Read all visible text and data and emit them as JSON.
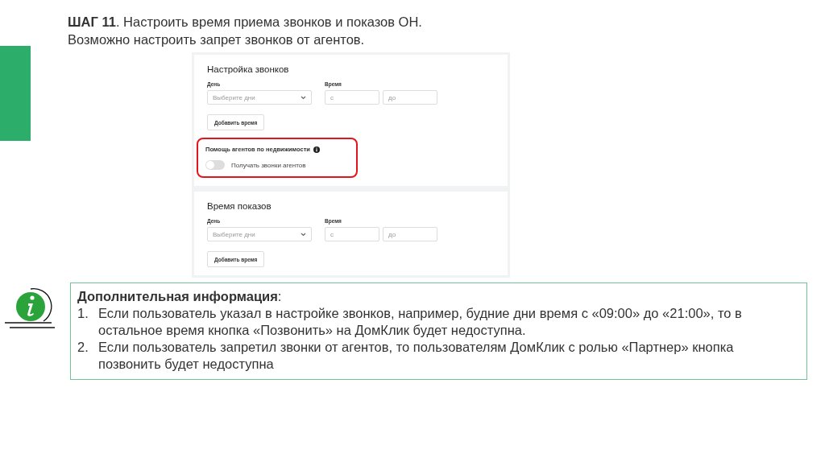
{
  "title_lines": [
    "**ШАГ 11**. Настроить время приема звонков и показов ОН.",
    "Возможно настроить запрет звонков от агентов."
  ],
  "sections": [
    {
      "heading": "Настройка звонков",
      "day_label": "День",
      "day_placeholder": "Выберите дни",
      "time_label": "Время",
      "from_placeholder": "с",
      "to_placeholder": "до",
      "button": "Добавить время",
      "agents": {
        "heading": "Помощь агентов по недвижимости",
        "toggle_label": "Получать звонки агентов",
        "on": false,
        "highlighted": true
      }
    },
    {
      "heading": "Время показов",
      "day_label": "День",
      "day_placeholder": "Выберите дни",
      "time_label": "Время",
      "from_placeholder": "с",
      "to_placeholder": "до",
      "button": "Добавить время"
    }
  ],
  "info": {
    "heading": "**Дополнительная информация**:",
    "items": [
      {
        "number": "1.",
        "text": "Если пользователь указал в настройке звонков, например, будние дни время с «09:00» до «21:00», то в остальное время кнопка «Позвонить» на ДомКлик будет недоступна."
      },
      {
        "number": "2.",
        "text": "Если пользователь запретил звонки от агентов, то пользователям ДомКлик с ролью «Партнер» кнопка позвонить будет недоступна"
      }
    ]
  }
}
